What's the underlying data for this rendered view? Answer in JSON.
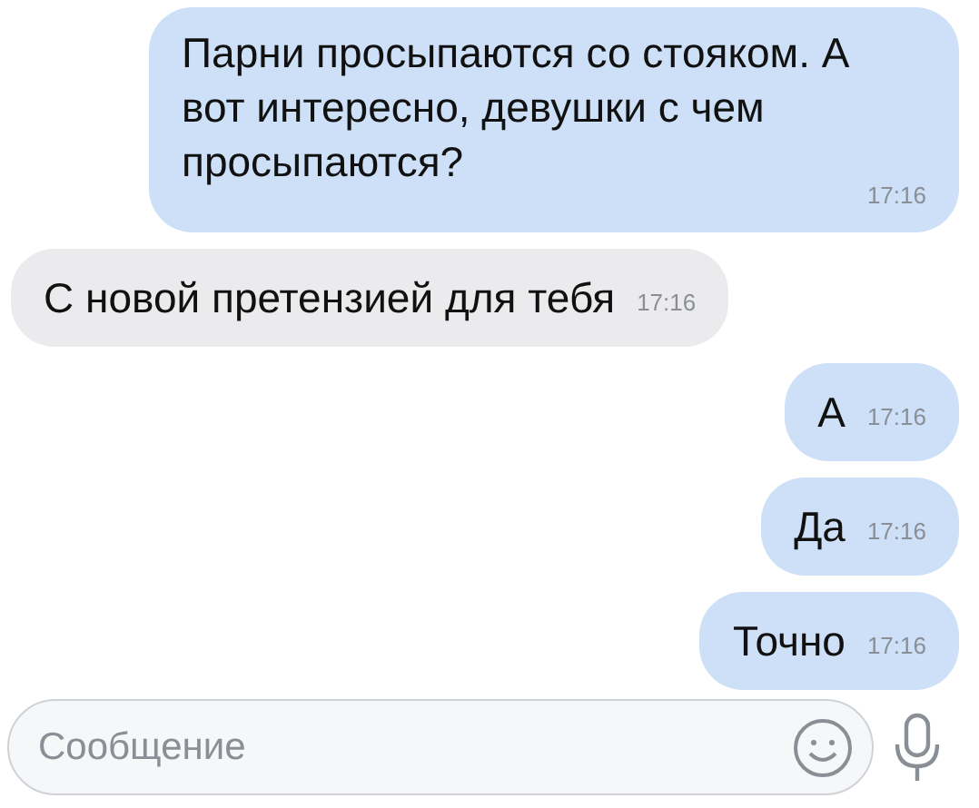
{
  "messages": [
    {
      "text": "Парни просыпаются со стояком. А вот интересно, девушки с чем просыпаются?",
      "time": "17:16",
      "outgoing": true
    },
    {
      "text": "С новой претензией для тебя",
      "time": "17:16",
      "outgoing": false
    },
    {
      "text": "А",
      "time": "17:16",
      "outgoing": true
    },
    {
      "text": "Да",
      "time": "17:16",
      "outgoing": true
    },
    {
      "text": "Точно",
      "time": "17:16",
      "outgoing": true
    }
  ],
  "composer": {
    "placeholder": "Сообщение"
  }
}
